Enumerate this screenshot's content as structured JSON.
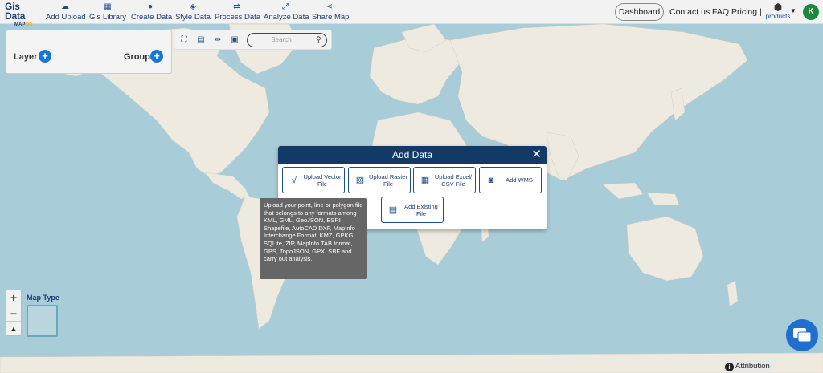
{
  "app": {
    "logo_line1": "Gis Data",
    "logo_line2_a": "MAP",
    "logo_line2_b": "OG"
  },
  "nav": [
    {
      "label": "Add Upload",
      "icon": "cloud-upload-icon"
    },
    {
      "label": "Gis Library",
      "icon": "library-icon"
    },
    {
      "label": "Create Data",
      "icon": "map-pin-icon"
    },
    {
      "label": "Style Data",
      "icon": "paint-icon"
    },
    {
      "label": "Process Data",
      "icon": "process-icon"
    },
    {
      "label": "Analyze Data",
      "icon": "analyze-icon"
    },
    {
      "label": "Share Map",
      "icon": "share-icon"
    }
  ],
  "header": {
    "dashboard": "Dashboard",
    "contact": "Contact us",
    "faq": "FAQ",
    "pricing": "Pricing |",
    "products": "products",
    "avatar_initial": "K"
  },
  "panel": {
    "layer_label": "Layer",
    "group_label": "Group"
  },
  "toolbar": {
    "search_placeholder": "Search"
  },
  "modal": {
    "title": "Add Data",
    "options": [
      {
        "label": "Upload Vector File",
        "icon": "vector-icon"
      },
      {
        "label": "Upload Raster File",
        "icon": "raster-icon"
      },
      {
        "label": "Upload Excel/ CSV File",
        "icon": "excel-icon"
      },
      {
        "label": "Add WMS",
        "icon": "wms-icon"
      },
      {
        "label": "Add Existing File",
        "icon": "existing-file-icon"
      }
    ]
  },
  "tooltip": {
    "text": "Upload your point, line or polygon file that belongs to any formats among KML, GML, GeoJSON, ESRI Shapefile, AutoCAD DXF, MapInfo Interchange Format, KMZ, GPKG, SQLite, ZIP, MapInfo TAB format, GPS, TopoJSON, GPX, SBF and carry out analysis."
  },
  "map_controls": {
    "zoom_in": "+",
    "zoom_out": "−",
    "map_type_label": "Map Type",
    "attribution": "Attribution"
  },
  "colors": {
    "navy": "#113a67",
    "accent_blue": "#1976d2",
    "ocean": "#a9cdd8",
    "land": "#efeae0",
    "avatar_green": "#1a8a3a"
  }
}
